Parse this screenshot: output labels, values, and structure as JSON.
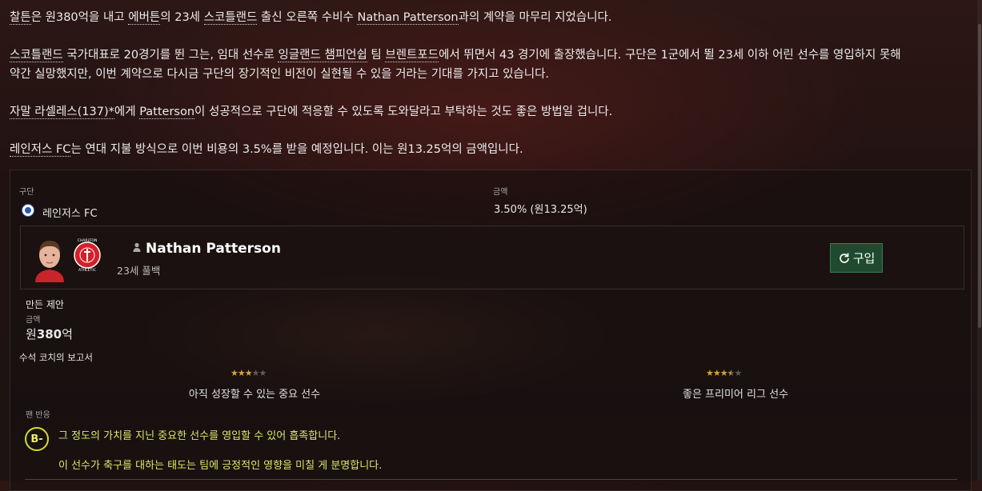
{
  "intro": {
    "p1": {
      "a": "찰튼",
      "b": "은 원380억을 내고 ",
      "c": "에버튼",
      "d": "의 23세 ",
      "e": "스코틀랜드",
      "f": " 출신 오른쪽 수비수 ",
      "g": "Nathan Patterson",
      "h": "과의 계약을 마무리 지었습니다."
    },
    "p2a": {
      "a": "스코틀랜드",
      "b": " 국가대표로 20경기를 뛴 그는, 임대 선수로 ",
      "c": "잉글랜드 챔피언쉽",
      "d": " 팀 ",
      "e": "브렌트포드",
      "f": "에서 뛰면서 43 경기에 출장했습니다. 구단은 1군에서 뛸 23세 이하 어린 선수를 영입하지 못해"
    },
    "p2b": "약간 실망했지만, 이번 계약으로 다시금 구단의 장기적인 비전이 실현될 수 있을 거라는 기대를 가지고 있습니다.",
    "p3": {
      "a": "자말 라셀레스(137)*",
      "b": "에게 ",
      "c": "Patterson",
      "d": "이 성공적으로 구단에 적응할 수 있도록 도와달라고 부탁하는 것도 좋은 방법일 겁니다."
    },
    "p4": {
      "a": "레인저스 FC",
      "b": "는 연대 지불 방식으로 이번 비용의 3.5%를 받을 예정입니다. 이는 원13.25억의 금액입니다."
    }
  },
  "clause": {
    "club_label": "구단",
    "club_name": "레인저스 FC",
    "amount_label": "금액",
    "amount_value": "3.50% (원13.25억)"
  },
  "player": {
    "name": "Nathan Patterson",
    "subtitle": "23세 풀백",
    "buy_label": "구입",
    "badge_text": {
      "top": "CHARLTON",
      "bottom": "ATHLETIC"
    }
  },
  "offer": {
    "label": "만든 제안",
    "fee_label": "금액",
    "fee_prefix": "원",
    "fee_value": "380",
    "fee_suffix": "억"
  },
  "report": {
    "title": "수석 코치의 보고서",
    "current_stars": 3,
    "current_text": "아직 성장할 수 있는 중요 선수",
    "potential_stars": 3.5,
    "potential_text": "좋은 프리미어 리그 선수"
  },
  "fans": {
    "label": "팬 반응",
    "grade": "B-",
    "line1": "그 정도의 가치를 지닌 중요한 선수를 영입할 수 있어 흡족합니다.",
    "line2": "이 선수가 축구를 대하는 태도는 팀에 긍정적인 영향을 미칠 게 분명합니다."
  },
  "colors": {
    "accent_green": "#1f4a2f",
    "grade_yellow": "#d5dc2c",
    "star_gold": "#d8a13b"
  }
}
